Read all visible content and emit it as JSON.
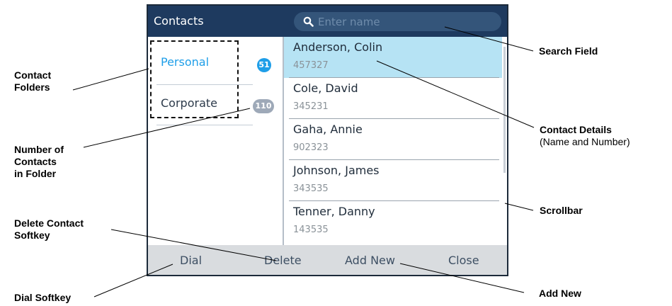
{
  "header": {
    "title": "Contacts",
    "search_placeholder": "Enter name"
  },
  "folders": [
    {
      "label": "Personal",
      "count": "51",
      "active": true
    },
    {
      "label": "Corporate",
      "count": "110",
      "active": false
    }
  ],
  "contacts": [
    {
      "name": "Anderson, Colin",
      "number": "457327",
      "selected": true
    },
    {
      "name": "Cole, David",
      "number": "345231"
    },
    {
      "name": "Gaha, Annie",
      "number": "902323"
    },
    {
      "name": "Johnson, James",
      "number": "343535"
    },
    {
      "name": "Tenner, Danny",
      "number": "143535"
    }
  ],
  "softkeys": {
    "dial": "Dial",
    "delete": "Delete",
    "add_new": "Add New",
    "close": "Close"
  },
  "callouts": {
    "search_field": "Search Field",
    "contact_folders_1": "Contact",
    "contact_folders_2": "Folders",
    "contact_details": "Contact Details",
    "contact_details_sub": "(Name and Number)",
    "number_of_contacts_1": "Number of",
    "number_of_contacts_2": "Contacts",
    "number_of_contacts_3": "in Folder",
    "scrollbar": "Scrollbar",
    "delete_softkey_1": "Delete Contact",
    "delete_softkey_2": "Softkey",
    "dial_softkey": "Dial Softkey",
    "add_new": "Add New"
  },
  "colors": {
    "titlebar": "#1e3a5f",
    "search_bg": "#34557a",
    "selected_row": "#b6e3f4",
    "personal_badge": "#1e9ee8",
    "corporate_badge": "#9ea9b8",
    "active_folder_text": "#1e9ee8",
    "softkey_bar": "#d9dcdf"
  }
}
